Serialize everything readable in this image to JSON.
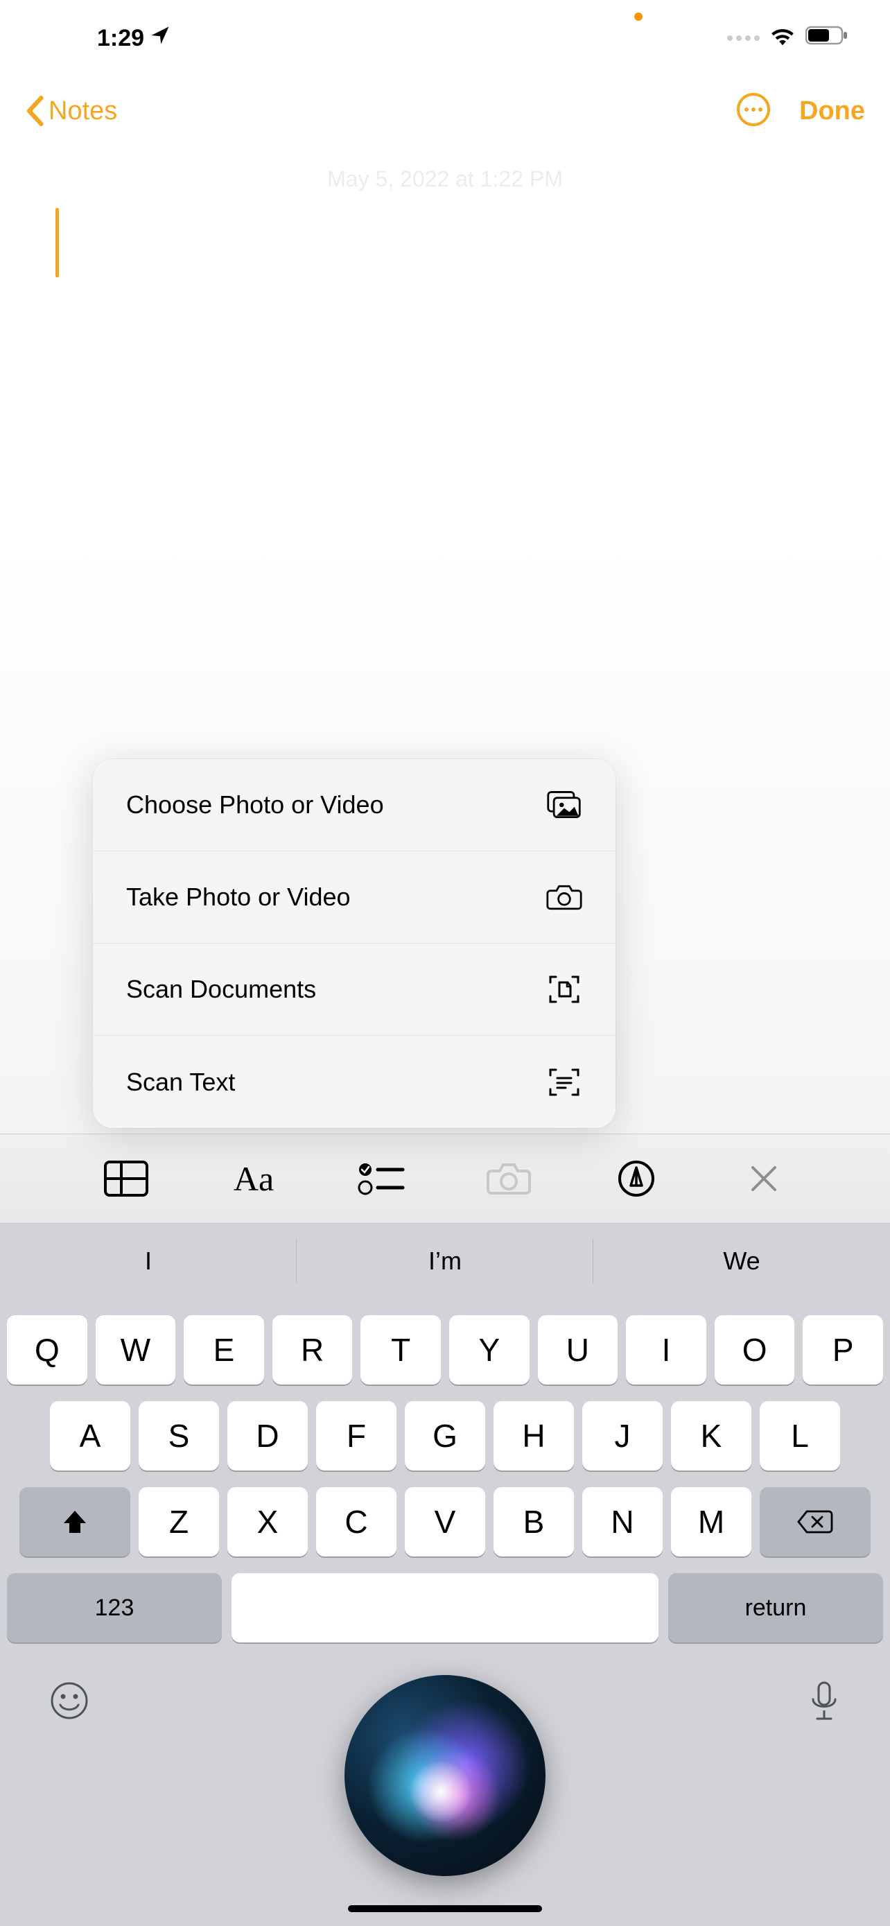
{
  "status": {
    "time": "1:29"
  },
  "nav": {
    "back": "Notes",
    "done": "Done"
  },
  "note": {
    "timestamp": "May 5, 2022 at 1:22 PM"
  },
  "popup": {
    "items": [
      {
        "label": "Choose Photo or Video"
      },
      {
        "label": "Take Photo or Video"
      },
      {
        "label": "Scan Documents"
      },
      {
        "label": "Scan Text"
      }
    ]
  },
  "suggestions": [
    "I",
    "I’m",
    "We"
  ],
  "keyboard": {
    "row1": [
      "Q",
      "W",
      "E",
      "R",
      "T",
      "Y",
      "U",
      "I",
      "O",
      "P"
    ],
    "row2": [
      "A",
      "S",
      "D",
      "F",
      "G",
      "H",
      "J",
      "K",
      "L"
    ],
    "row3": [
      "Z",
      "X",
      "C",
      "V",
      "B",
      "N",
      "M"
    ],
    "numKey": "123",
    "returnKey": "return"
  }
}
